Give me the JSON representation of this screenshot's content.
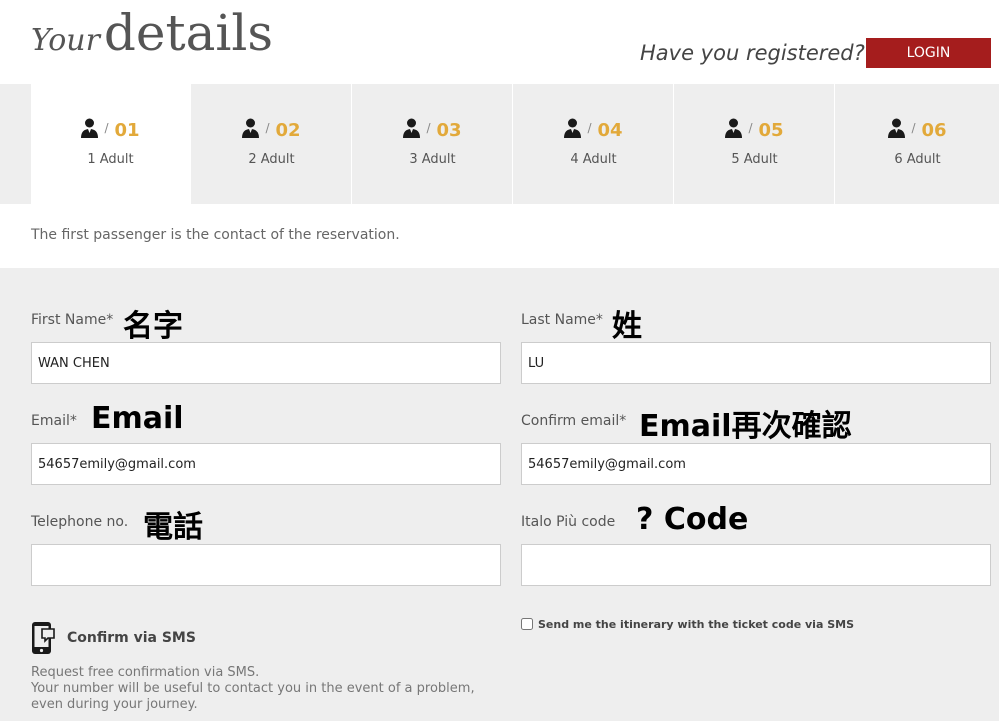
{
  "header": {
    "title_italic": "Your",
    "title_main": "details",
    "registered_text": "Have you registered?",
    "login_label": "LOGIN",
    "login_color": "#a51d1d"
  },
  "tabs": [
    {
      "number": "01",
      "label": "1 Adult",
      "active": true
    },
    {
      "number": "02",
      "label": "2 Adult"
    },
    {
      "number": "03",
      "label": "3 Adult"
    },
    {
      "number": "04",
      "label": "4 Adult"
    },
    {
      "number": "05",
      "label": "5 Adult"
    },
    {
      "number": "06",
      "label": "6 Adult"
    }
  ],
  "tab_slash": "/",
  "tab_icon": "person-icon",
  "note": "The first passenger is the contact of the reservation.",
  "form": {
    "first_name": {
      "label": "First Name*",
      "annotation": "名字",
      "value": "WAN CHEN"
    },
    "last_name": {
      "label": "Last Name*",
      "annotation": "姓",
      "value": "LU"
    },
    "email": {
      "label": "Email*",
      "annotation": "Email",
      "value": "54657emily@gmail.com"
    },
    "confirm_email": {
      "label": "Confirm email*",
      "annotation": "Email再次確認",
      "value": "54657emily@gmail.com"
    },
    "telephone": {
      "label": "Telephone no.",
      "annotation": "電話",
      "value": ""
    },
    "italo_code": {
      "label": "Italo Più code",
      "annotation": "? Code",
      "value": ""
    }
  },
  "sms": {
    "icon": "phone-sms-icon",
    "title": "Confirm via SMS",
    "desc_line1": "Request free confirmation via SMS.",
    "desc_line2": "Your number will be useful to contact you in the event of a problem,",
    "desc_line3": "even during your journey.",
    "checkbox_label": "Send me the itinerary with the ticket code via SMS"
  }
}
